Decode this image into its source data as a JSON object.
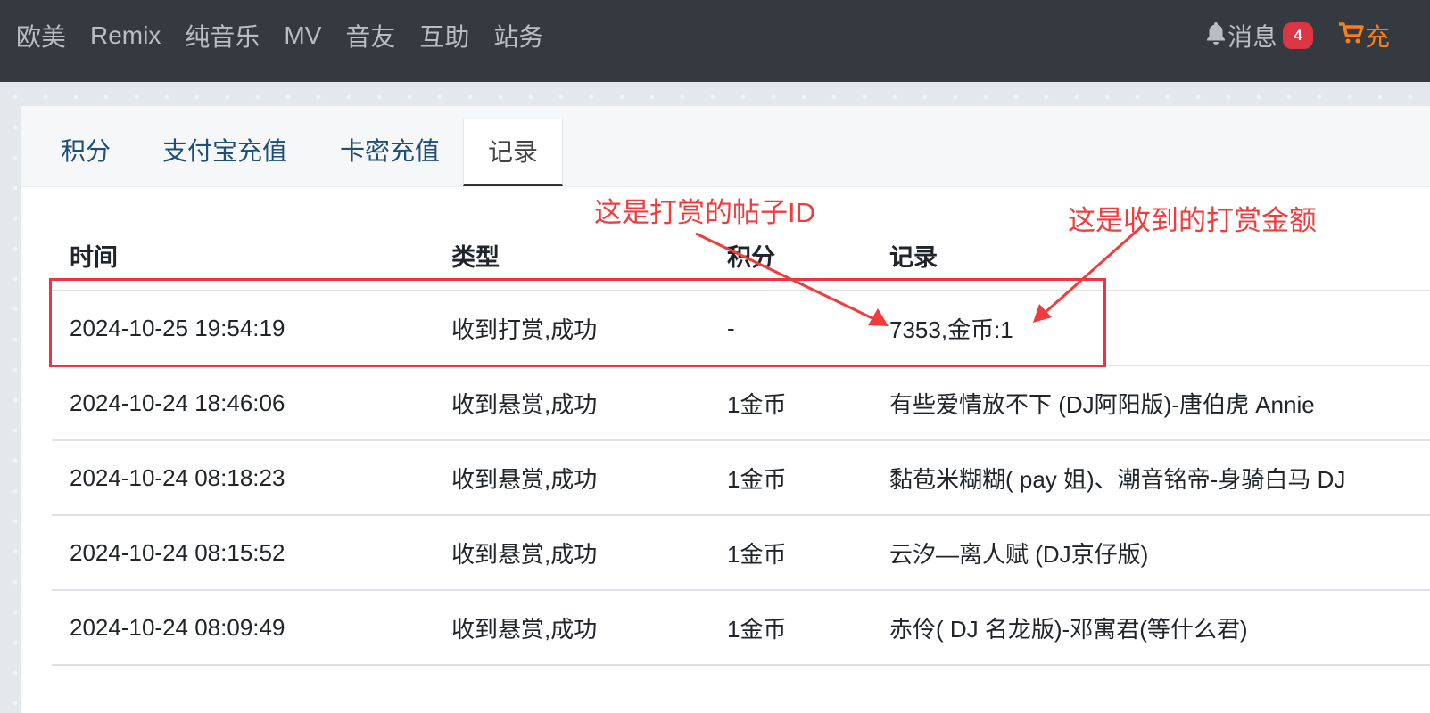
{
  "nav": {
    "links": [
      "欧美",
      "Remix",
      "纯音乐",
      "MV",
      "音友",
      "互助",
      "站务"
    ],
    "messages_label": "消息",
    "messages_count": "4",
    "charge_label": "充"
  },
  "tabs": [
    "积分",
    "支付宝充值",
    "卡密充值",
    "记录"
  ],
  "active_tab": "记录",
  "table": {
    "headers": [
      "时间",
      "类型",
      "积分",
      "记录"
    ],
    "rows": [
      [
        "2024-10-25 19:54:19",
        "收到打赏,成功",
        "-",
        "7353,金币:1"
      ],
      [
        "2024-10-24 18:46:06",
        "收到悬赏,成功",
        "1金币",
        "有些爱情放不下 (DJ阿阳版)-唐伯虎 Annie"
      ],
      [
        "2024-10-24 08:18:23",
        "收到悬赏,成功",
        "1金币",
        "黏苞米糊糊( pay 姐)、潮音铭帝-身骑白马 DJ"
      ],
      [
        "2024-10-24 08:15:52",
        "收到悬赏,成功",
        "1金币",
        "云汐—离人赋 (DJ京仔版)"
      ],
      [
        "2024-10-24 08:09:49",
        "收到悬赏,成功",
        "1金币",
        "赤伶( DJ 名龙版)-邓寓君(等什么君)"
      ]
    ]
  },
  "annotations": {
    "post_id": "这是打赏的帖子ID",
    "amount": "这是收到的打赏金额",
    "color": "#f03c3c"
  }
}
